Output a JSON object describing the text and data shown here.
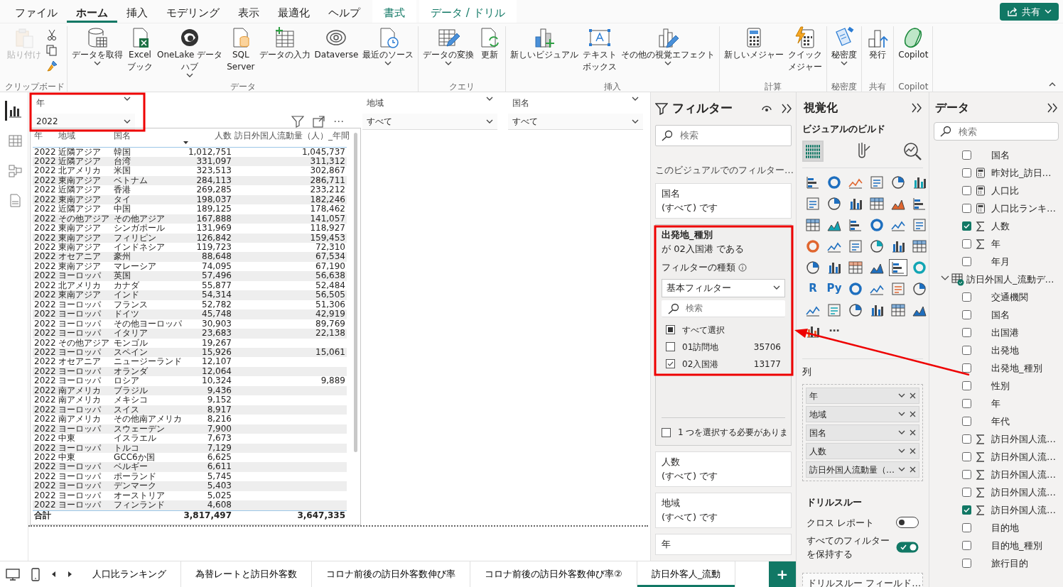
{
  "tabs": [
    {
      "label": "ファイル",
      "selected": false,
      "kind": "normal"
    },
    {
      "label": "ホーム",
      "selected": true,
      "kind": "normal"
    },
    {
      "label": "挿入",
      "selected": false,
      "kind": "normal"
    },
    {
      "label": "モデリング",
      "selected": false,
      "kind": "normal"
    },
    {
      "label": "表示",
      "selected": false,
      "kind": "normal"
    },
    {
      "label": "最適化",
      "selected": false,
      "kind": "normal"
    },
    {
      "label": "ヘルプ",
      "selected": false,
      "kind": "normal"
    },
    {
      "label": "書式",
      "selected": false,
      "kind": "context"
    },
    {
      "label": "データ / ドリル",
      "selected": false,
      "kind": "context"
    }
  ],
  "share_button": "共有",
  "ribbon_groups": [
    {
      "label": "クリップボード",
      "kind": "clipboard",
      "buttons": [
        {
          "lines": [
            "貼り付け"
          ],
          "disabled": true,
          "menu": false
        }
      ]
    },
    {
      "label": "データ",
      "kind": "normal",
      "buttons": [
        {
          "lines": [
            "データを取得"
          ],
          "disabled": false,
          "menu": true
        },
        {
          "lines": [
            "Excel",
            "ブック"
          ],
          "disabled": false,
          "menu": false
        },
        {
          "lines": [
            "OneLake データ",
            "ハブ"
          ],
          "disabled": false,
          "menu": true
        },
        {
          "lines": [
            "SQL",
            "Server"
          ],
          "disabled": false,
          "menu": false
        },
        {
          "lines": [
            "データの入力"
          ],
          "disabled": false,
          "menu": false
        },
        {
          "lines": [
            "Dataverse"
          ],
          "disabled": false,
          "menu": false
        },
        {
          "lines": [
            "最近のソース"
          ],
          "disabled": false,
          "menu": true
        }
      ]
    },
    {
      "label": "クエリ",
      "kind": "normal",
      "buttons": [
        {
          "lines": [
            "データの変換"
          ],
          "disabled": false,
          "menu": true
        },
        {
          "lines": [
            "更新"
          ],
          "disabled": false,
          "menu": false
        }
      ]
    },
    {
      "label": "挿入",
      "kind": "normal",
      "buttons": [
        {
          "lines": [
            "新しいビジュアル"
          ],
          "disabled": false,
          "menu": false
        },
        {
          "lines": [
            "テキスト",
            "ボックス"
          ],
          "disabled": false,
          "menu": false
        },
        {
          "lines": [
            "その他の視覚エフェクト"
          ],
          "disabled": false,
          "menu": true
        }
      ]
    },
    {
      "label": "計算",
      "kind": "normal",
      "buttons": [
        {
          "lines": [
            "新しいメジャー"
          ],
          "disabled": false,
          "menu": false
        },
        {
          "lines": [
            "クイック",
            "メジャー"
          ],
          "disabled": false,
          "menu": false
        }
      ]
    },
    {
      "label": "秘密度",
      "kind": "normal",
      "buttons": [
        {
          "lines": [
            "秘密度"
          ],
          "disabled": false,
          "menu": true
        }
      ]
    },
    {
      "label": "共有",
      "kind": "normal",
      "buttons": [
        {
          "lines": [
            "発行"
          ],
          "disabled": false,
          "menu": false
        }
      ]
    },
    {
      "label": "Copilot",
      "kind": "normal",
      "buttons": [
        {
          "lines": [
            "Copilot"
          ],
          "disabled": false,
          "menu": false
        }
      ]
    }
  ],
  "views": [
    {
      "selected": true
    },
    {
      "selected": false
    },
    {
      "selected": false
    },
    {
      "selected": false
    }
  ],
  "slicers": [
    {
      "title": "年",
      "value": "2022"
    },
    {
      "title": "地域",
      "value": "すべて"
    },
    {
      "title": "国名",
      "value": "すべて"
    }
  ],
  "visual_menu": "⋯",
  "table": {
    "columns": [
      {
        "label": "年",
        "sorted": false
      },
      {
        "label": "地域",
        "sorted": false
      },
      {
        "label": "国名",
        "sorted": false
      },
      {
        "label": "人数",
        "sorted": true
      },
      {
        "label": "訪日外国人流動量（人）_年間",
        "sorted": false
      }
    ],
    "rows": [
      {
        "year": "2022",
        "region": "近隣アジア",
        "country": "韓国",
        "count": "1,012,751",
        "volume": "1,045,737"
      },
      {
        "year": "2022",
        "region": "近隣アジア",
        "country": "台湾",
        "count": "331,097",
        "volume": "311,312"
      },
      {
        "year": "2022",
        "region": "北アメリカ",
        "country": "米国",
        "count": "323,513",
        "volume": "302,867"
      },
      {
        "year": "2022",
        "region": "東南アジア",
        "country": "ベトナム",
        "count": "284,113",
        "volume": "286,711"
      },
      {
        "year": "2022",
        "region": "近隣アジア",
        "country": "香港",
        "count": "269,285",
        "volume": "233,212"
      },
      {
        "year": "2022",
        "region": "東南アジア",
        "country": "タイ",
        "count": "198,037",
        "volume": "182,246"
      },
      {
        "year": "2022",
        "region": "近隣アジア",
        "country": "中国",
        "count": "189,125",
        "volume": "178,462"
      },
      {
        "year": "2022",
        "region": "その他アジア",
        "country": "その他アジア",
        "count": "167,888",
        "volume": "141,057"
      },
      {
        "year": "2022",
        "region": "東南アジア",
        "country": "シンガポール",
        "count": "131,969",
        "volume": "118,927"
      },
      {
        "year": "2022",
        "region": "東南アジア",
        "country": "フィリピン",
        "count": "126,842",
        "volume": "159,453"
      },
      {
        "year": "2022",
        "region": "東南アジア",
        "country": "インドネシア",
        "count": "119,723",
        "volume": "72,310"
      },
      {
        "year": "2022",
        "region": "オセアニア",
        "country": "豪州",
        "count": "88,648",
        "volume": "67,534"
      },
      {
        "year": "2022",
        "region": "東南アジア",
        "country": "マレーシア",
        "count": "74,095",
        "volume": "67,190"
      },
      {
        "year": "2022",
        "region": "ヨーロッパ",
        "country": "英国",
        "count": "57,496",
        "volume": "56,638"
      },
      {
        "year": "2022",
        "region": "北アメリカ",
        "country": "カナダ",
        "count": "55,877",
        "volume": "52,484"
      },
      {
        "year": "2022",
        "region": "東南アジア",
        "country": "インド",
        "count": "54,314",
        "volume": "56,505"
      },
      {
        "year": "2022",
        "region": "ヨーロッパ",
        "country": "フランス",
        "count": "52,782",
        "volume": "51,306"
      },
      {
        "year": "2022",
        "region": "ヨーロッパ",
        "country": "ドイツ",
        "count": "45,748",
        "volume": "42,919"
      },
      {
        "year": "2022",
        "region": "ヨーロッパ",
        "country": "その他ヨーロッパ",
        "count": "30,903",
        "volume": "89,769"
      },
      {
        "year": "2022",
        "region": "ヨーロッパ",
        "country": "イタリア",
        "count": "23,683",
        "volume": "22,138"
      },
      {
        "year": "2022",
        "region": "その他アジア",
        "country": "モンゴル",
        "count": "19,267"
      },
      {
        "year": "2022",
        "region": "ヨーロッパ",
        "country": "スペイン",
        "count": "15,926",
        "volume": "15,061"
      },
      {
        "year": "2022",
        "region": "オセアニア",
        "country": "ニュージーランド",
        "count": "12,107"
      },
      {
        "year": "2022",
        "region": "ヨーロッパ",
        "country": "オランダ",
        "count": "12,064"
      },
      {
        "year": "2022",
        "region": "ヨーロッパ",
        "country": "ロシア",
        "count": "10,324",
        "volume": "9,889"
      },
      {
        "year": "2022",
        "region": "南アメリカ",
        "country": "ブラジル",
        "count": "9,436"
      },
      {
        "year": "2022",
        "region": "南アメリカ",
        "country": "メキシコ",
        "count": "9,152"
      },
      {
        "year": "2022",
        "region": "ヨーロッパ",
        "country": "スイス",
        "count": "8,917"
      },
      {
        "year": "2022",
        "region": "南アメリカ",
        "country": "その他南アメリカ",
        "count": "8,216"
      },
      {
        "year": "2022",
        "region": "ヨーロッパ",
        "country": "スウェーデン",
        "count": "7,900"
      },
      {
        "year": "2022",
        "region": "中東",
        "country": "イスラエル",
        "count": "7,673"
      },
      {
        "year": "2022",
        "region": "ヨーロッパ",
        "country": "トルコ",
        "count": "7,129"
      },
      {
        "year": "2022",
        "region": "中東",
        "country": "GCC6か国",
        "count": "6,625"
      },
      {
        "year": "2022",
        "region": "ヨーロッパ",
        "country": "ベルギー",
        "count": "6,611"
      },
      {
        "year": "2022",
        "region": "ヨーロッパ",
        "country": "ポーランド",
        "count": "5,745"
      },
      {
        "year": "2022",
        "region": "ヨーロッパ",
        "country": "デンマーク",
        "count": "5,403"
      },
      {
        "year": "2022",
        "region": "ヨーロッパ",
        "country": "オーストリア",
        "count": "5,025"
      },
      {
        "year": "2022",
        "region": "ヨーロッパ",
        "country": "フィンランド",
        "count": "4,608"
      }
    ],
    "total": {
      "year": "合計",
      "count": "3,817,497",
      "volume": "3,647,335"
    }
  },
  "pages": [
    {
      "label": "人口比ランキング",
      "selected": false
    },
    {
      "label": "為替レートと訪日外客数",
      "selected": false
    },
    {
      "label": "コロナ前後の訪日外客数伸び率",
      "selected": false
    },
    {
      "label": "コロナ前後の訪日外客数伸び率②",
      "selected": false
    },
    {
      "label": "訪日外客人_流動",
      "selected": true
    }
  ],
  "add_page": "+",
  "filters": {
    "title": "フィルター",
    "search_placeholder": "検索",
    "section_label": "このビジュアルでのフィルター…",
    "cards": [
      {
        "kind": "summary",
        "field": "国名",
        "summary": "(すべて) です"
      },
      {
        "kind": "expanded",
        "field": "出発地_種別",
        "summary": "が 02入国港 である",
        "type_label": "フィルターの種類",
        "type_value": "基本フィルター",
        "search_placeholder": "検索",
        "items": [
          {
            "label": "すべて選択",
            "checked": false,
            "partial": true
          },
          {
            "label": "01訪問地",
            "count": "35706",
            "checked": false,
            "partial": false
          },
          {
            "label": "02入国港",
            "count": "13177",
            "checked": true,
            "partial": false
          }
        ],
        "require_single": {
          "label": "1 つを選択する必要がありま",
          "checked": false
        }
      },
      {
        "kind": "summary",
        "field": "人数",
        "summary": "(すべて) です"
      },
      {
        "kind": "summary",
        "field": "地域",
        "summary": "(すべて) です"
      },
      {
        "kind": "summary",
        "field": "年"
      }
    ]
  },
  "visualizations": {
    "title": "視覚化",
    "subtitle": "ビジュアルのビルド",
    "modes": [
      {
        "selected": true
      },
      {
        "selected": false
      },
      {
        "selected": false
      }
    ],
    "gallery": [
      {
        "kind": "icon",
        "selected": false
      },
      {
        "kind": "icon",
        "selected": false
      },
      {
        "kind": "icon",
        "selected": false
      },
      {
        "kind": "icon",
        "selected": false
      },
      {
        "kind": "icon",
        "selected": false
      },
      {
        "kind": "icon",
        "selected": false
      },
      {
        "kind": "icon",
        "selected": false
      },
      {
        "kind": "icon",
        "selected": false
      },
      {
        "kind": "icon",
        "selected": false
      },
      {
        "kind": "icon",
        "selected": false
      },
      {
        "kind": "icon",
        "selected": false
      },
      {
        "kind": "icon",
        "selected": false
      },
      {
        "kind": "icon",
        "selected": false
      },
      {
        "kind": "icon",
        "selected": false
      },
      {
        "kind": "icon",
        "selected": false
      },
      {
        "kind": "icon",
        "selected": false
      },
      {
        "kind": "icon",
        "selected": false
      },
      {
        "kind": "icon",
        "selected": false
      },
      {
        "kind": "icon",
        "selected": false
      },
      {
        "kind": "icon",
        "selected": false
      },
      {
        "kind": "icon",
        "selected": false
      },
      {
        "kind": "icon",
        "selected": false
      },
      {
        "kind": "icon",
        "selected": false
      },
      {
        "kind": "icon",
        "selected": false
      },
      {
        "kind": "icon",
        "selected": false
      },
      {
        "kind": "icon",
        "selected": false
      },
      {
        "kind": "icon",
        "selected": false
      },
      {
        "kind": "icon",
        "selected": false
      },
      {
        "kind": "icon",
        "selected": true
      },
      {
        "kind": "icon",
        "selected": false
      },
      {
        "kind": "text",
        "label": "R",
        "selected": false
      },
      {
        "kind": "text",
        "label": "Py",
        "selected": false
      },
      {
        "kind": "icon",
        "selected": false
      },
      {
        "kind": "icon",
        "selected": false
      },
      {
        "kind": "icon",
        "selected": false
      },
      {
        "kind": "icon",
        "selected": false
      },
      {
        "kind": "icon",
        "selected": false
      },
      {
        "kind": "icon",
        "selected": false
      },
      {
        "kind": "icon",
        "selected": false
      },
      {
        "kind": "icon",
        "selected": false
      },
      {
        "kind": "icon",
        "selected": false
      },
      {
        "kind": "icon",
        "selected": false
      },
      {
        "kind": "icon",
        "selected": false
      },
      {
        "kind": "text",
        "label": "⋯",
        "selected": false
      }
    ],
    "wells_label": "列",
    "wells": [
      "年",
      "地域",
      "国名",
      "人数",
      "訪日外国人流動量（…"
    ],
    "drillthrough": {
      "title": "ドリルスルー",
      "toggles": [
        {
          "lines": [
            "クロス レポート"
          ],
          "on": false
        },
        {
          "lines": [
            "すべてのフィルター",
            "を保持する"
          ],
          "on": true
        }
      ],
      "drop_zone": "ドリルスルー フィールド…"
    }
  },
  "data_pane": {
    "title": "データ",
    "search_placeholder": "検索",
    "tree": [
      {
        "kind": "field",
        "label": "国名",
        "checked": false
      },
      {
        "kind": "measure",
        "label": "昨対比_訪日…",
        "checked": false
      },
      {
        "kind": "measure",
        "label": "人口比",
        "checked": false
      },
      {
        "kind": "measure",
        "label": "人口比ランキ…",
        "checked": false
      },
      {
        "kind": "sum",
        "label": "人数",
        "checked": true
      },
      {
        "kind": "sum",
        "label": "年",
        "checked": false
      },
      {
        "kind": "field",
        "label": "年月",
        "checked": false
      },
      {
        "kind": "table",
        "label": "訪日外国人_流動デ…",
        "expanded": true,
        "children": [
          {
            "kind": "field",
            "label": "交通機関",
            "checked": false
          },
          {
            "kind": "field",
            "label": "国名",
            "checked": false
          },
          {
            "kind": "field",
            "label": "出国港",
            "checked": false
          },
          {
            "kind": "field",
            "label": "出発地",
            "checked": false
          },
          {
            "kind": "field",
            "label": "出発地_種別",
            "checked": false
          },
          {
            "kind": "field",
            "label": "性別",
            "checked": false
          },
          {
            "kind": "field",
            "label": "年",
            "checked": false
          },
          {
            "kind": "field",
            "label": "年代",
            "checked": false
          },
          {
            "kind": "sum",
            "label": "訪日外国人流…",
            "checked": false
          },
          {
            "kind": "sum",
            "label": "訪日外国人流…",
            "checked": false
          },
          {
            "kind": "sum",
            "label": "訪日外国人流…",
            "checked": false
          },
          {
            "kind": "sum",
            "label": "訪日外国人流…",
            "checked": false
          },
          {
            "kind": "sum",
            "label": "訪日外国人流…",
            "checked": true
          },
          {
            "kind": "field",
            "label": "目的地",
            "checked": false
          },
          {
            "kind": "field",
            "label": "目的地_種別",
            "checked": false
          },
          {
            "kind": "field",
            "label": "旅行目的",
            "checked": false
          }
        ]
      }
    ]
  }
}
